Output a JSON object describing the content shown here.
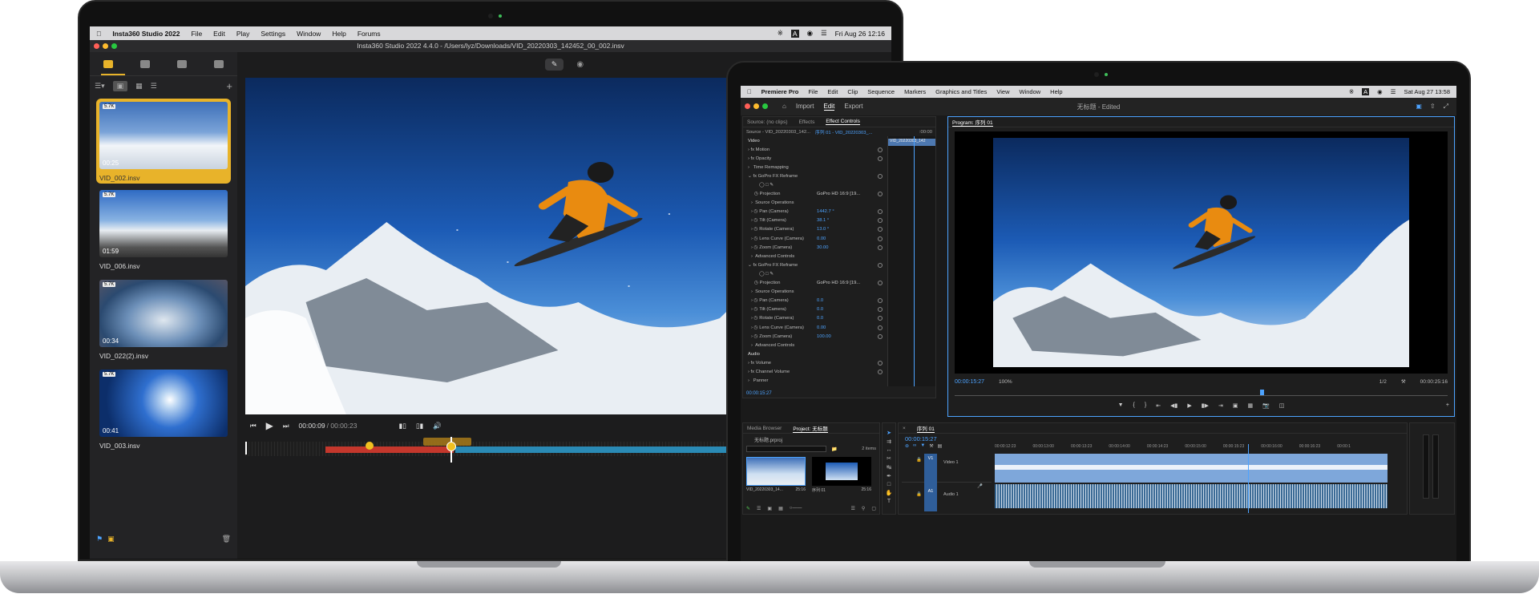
{
  "insta360": {
    "menubar": {
      "app_name": "Insta360 Studio 2022",
      "menus": [
        "File",
        "Edit",
        "Play",
        "Settings",
        "Window",
        "Help",
        "Forums"
      ],
      "clock": "Fri Aug 26  12:16"
    },
    "window_title": "Insta360 Studio 2022 4.4.0 - /Users/lyz/Downloads/VID_20220303_142452_00_002.insv",
    "clips": [
      {
        "name": "VID_002.insv",
        "duration": "00:25",
        "badge": "5.7K"
      },
      {
        "name": "VID_006.insv",
        "duration": "01:59",
        "badge": "5.7K"
      },
      {
        "name": "VID_022(2).insv",
        "duration": "00:34",
        "badge": "5.7K"
      },
      {
        "name": "VID_003.insv",
        "duration": "00:41",
        "badge": "5.7K"
      }
    ],
    "playback": {
      "current": "00:00:09",
      "total": "/ 00:00:23",
      "progress": 0.4
    }
  },
  "premiere": {
    "menubar": {
      "app_name": "Premiere Pro",
      "menus": [
        "File",
        "Edit",
        "Clip",
        "Sequence",
        "Markers",
        "Graphics and Titles",
        "View",
        "Window",
        "Help"
      ],
      "clock": "Sat Aug 27  13:58"
    },
    "nav": {
      "import": "Import",
      "edit": "Edit",
      "export": "Export"
    },
    "project_title": "无标题 - Edited",
    "source_tabs": {
      "source": "Source: (no clips)",
      "effects": "Effects",
      "effect_controls": "Effect Controls"
    },
    "source_path": "Source - VID_20220303_142...",
    "sequence_path": "序列 01 - VID_20220303_...",
    "timecode_small": ":00:00",
    "clip_label": "VID_20220303_142",
    "effect_rows": [
      {
        "label": "Video",
        "value": "",
        "type": "header"
      },
      {
        "label": "Motion",
        "value": "",
        "type": "fx"
      },
      {
        "label": "Opacity",
        "value": "",
        "type": "fx"
      },
      {
        "label": "Time Remapping",
        "value": "",
        "type": "sub"
      },
      {
        "label": "GoPro FX Reframe",
        "value": "",
        "type": "fx"
      },
      {
        "label": "",
        "value": "",
        "type": "icons"
      },
      {
        "label": "Projection",
        "value": "GoPro HD 16:9  [19...",
        "type": "dd"
      },
      {
        "label": "Source Operations",
        "value": "",
        "type": "sub"
      },
      {
        "label": "Pan (Camera)",
        "value": "1442.7 °",
        "type": "val"
      },
      {
        "label": "Tilt (Camera)",
        "value": "38.1 °",
        "type": "val"
      },
      {
        "label": "Rotate (Camera)",
        "value": "13.0 °",
        "type": "val"
      },
      {
        "label": "Lens Curve (Camera)",
        "value": "0.00",
        "type": "val"
      },
      {
        "label": "Zoom (Camera)",
        "value": "30.00",
        "type": "val"
      },
      {
        "label": "Advanced Controls",
        "value": "",
        "type": "sub"
      },
      {
        "label": "GoPro FX Reframe",
        "value": "",
        "type": "fx"
      },
      {
        "label": "",
        "value": "",
        "type": "icons"
      },
      {
        "label": "Projection",
        "value": "GoPro HD 16:9  [19...",
        "type": "dd"
      },
      {
        "label": "Source Operations",
        "value": "",
        "type": "sub"
      },
      {
        "label": "Pan (Camera)",
        "value": "0.0",
        "type": "val"
      },
      {
        "label": "Tilt (Camera)",
        "value": "0.0",
        "type": "val"
      },
      {
        "label": "Rotate (Camera)",
        "value": "0.0",
        "type": "val"
      },
      {
        "label": "Lens Curve (Camera)",
        "value": "0.00",
        "type": "val"
      },
      {
        "label": "Zoom (Camera)",
        "value": "100.00",
        "type": "val"
      },
      {
        "label": "Advanced Controls",
        "value": "",
        "type": "sub"
      },
      {
        "label": "Audio",
        "value": "",
        "type": "header"
      },
      {
        "label": "Volume",
        "value": "",
        "type": "fx"
      },
      {
        "label": "Channel Volume",
        "value": "",
        "type": "fx"
      },
      {
        "label": "Panner",
        "value": "",
        "type": "sub"
      }
    ],
    "ec_timecode": "00:00:15:27",
    "program": {
      "tab": "Program: 序列 01",
      "timecode": "00:00:15:27",
      "zoom": "100%",
      "resolution": "1/2",
      "duration": "00:00:25:16"
    },
    "project": {
      "tabs": [
        "Media Browser",
        "Project: 无标题"
      ],
      "file": "无标题.prproj",
      "items_count": "2 items",
      "items": [
        {
          "name": "VID_20220303_14...",
          "duration": "25:16"
        },
        {
          "name": "序列 01",
          "duration": "25:16"
        }
      ]
    },
    "timeline": {
      "tab": "序列 01",
      "timecode": "00:00:15:27",
      "ruler": [
        "00:00:12:23",
        "00:00:13:00",
        "00:00:13:23",
        "00:00:14:00",
        "00:00:14:23",
        "00:00:15:00",
        "00:00:15:23",
        "00:00:16:00",
        "00:00:16:23",
        "00:00:1"
      ],
      "video_track": "Video 1",
      "audio_track": "Audio 1",
      "v1": "V1",
      "a1": "A1"
    }
  }
}
